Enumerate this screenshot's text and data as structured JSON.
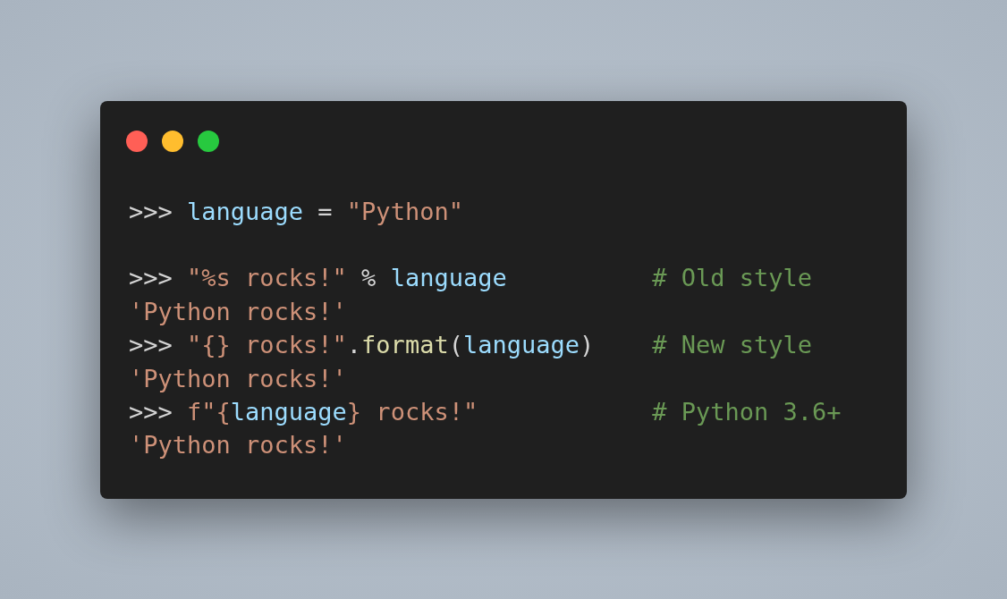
{
  "code_blocks": [
    [
      {
        "tokens": [
          {
            "kind": "prompt",
            "text": ">>> "
          },
          {
            "kind": "variable",
            "text": "language"
          },
          {
            "kind": "operator",
            "text": " = "
          },
          {
            "kind": "string",
            "text": "\"Python\""
          }
        ]
      }
    ],
    [
      {
        "tokens": [
          {
            "kind": "prompt",
            "text": ">>> "
          },
          {
            "kind": "string",
            "text": "\"%s rocks!\""
          },
          {
            "kind": "operator",
            "text": " % "
          },
          {
            "kind": "variable",
            "text": "language"
          }
        ],
        "comment": "# Old style"
      },
      {
        "tokens": [
          {
            "kind": "output",
            "text": "'Python rocks!'"
          }
        ]
      },
      {
        "tokens": [
          {
            "kind": "prompt",
            "text": ">>> "
          },
          {
            "kind": "string",
            "text": "\"{} rocks!\""
          },
          {
            "kind": "operator",
            "text": "."
          },
          {
            "kind": "method",
            "text": "format"
          },
          {
            "kind": "operator",
            "text": "("
          },
          {
            "kind": "variable",
            "text": "language"
          },
          {
            "kind": "operator",
            "text": ")"
          }
        ],
        "comment": "# New style"
      },
      {
        "tokens": [
          {
            "kind": "output",
            "text": "'Python rocks!'"
          }
        ]
      },
      {
        "tokens": [
          {
            "kind": "prompt",
            "text": ">>> "
          },
          {
            "kind": "string",
            "text": "f\"{"
          },
          {
            "kind": "variable",
            "text": "language"
          },
          {
            "kind": "string",
            "text": "} rocks!\""
          }
        ],
        "comment": "# Python 3.6+"
      },
      {
        "tokens": [
          {
            "kind": "output",
            "text": "'Python rocks!'"
          }
        ]
      }
    ]
  ]
}
